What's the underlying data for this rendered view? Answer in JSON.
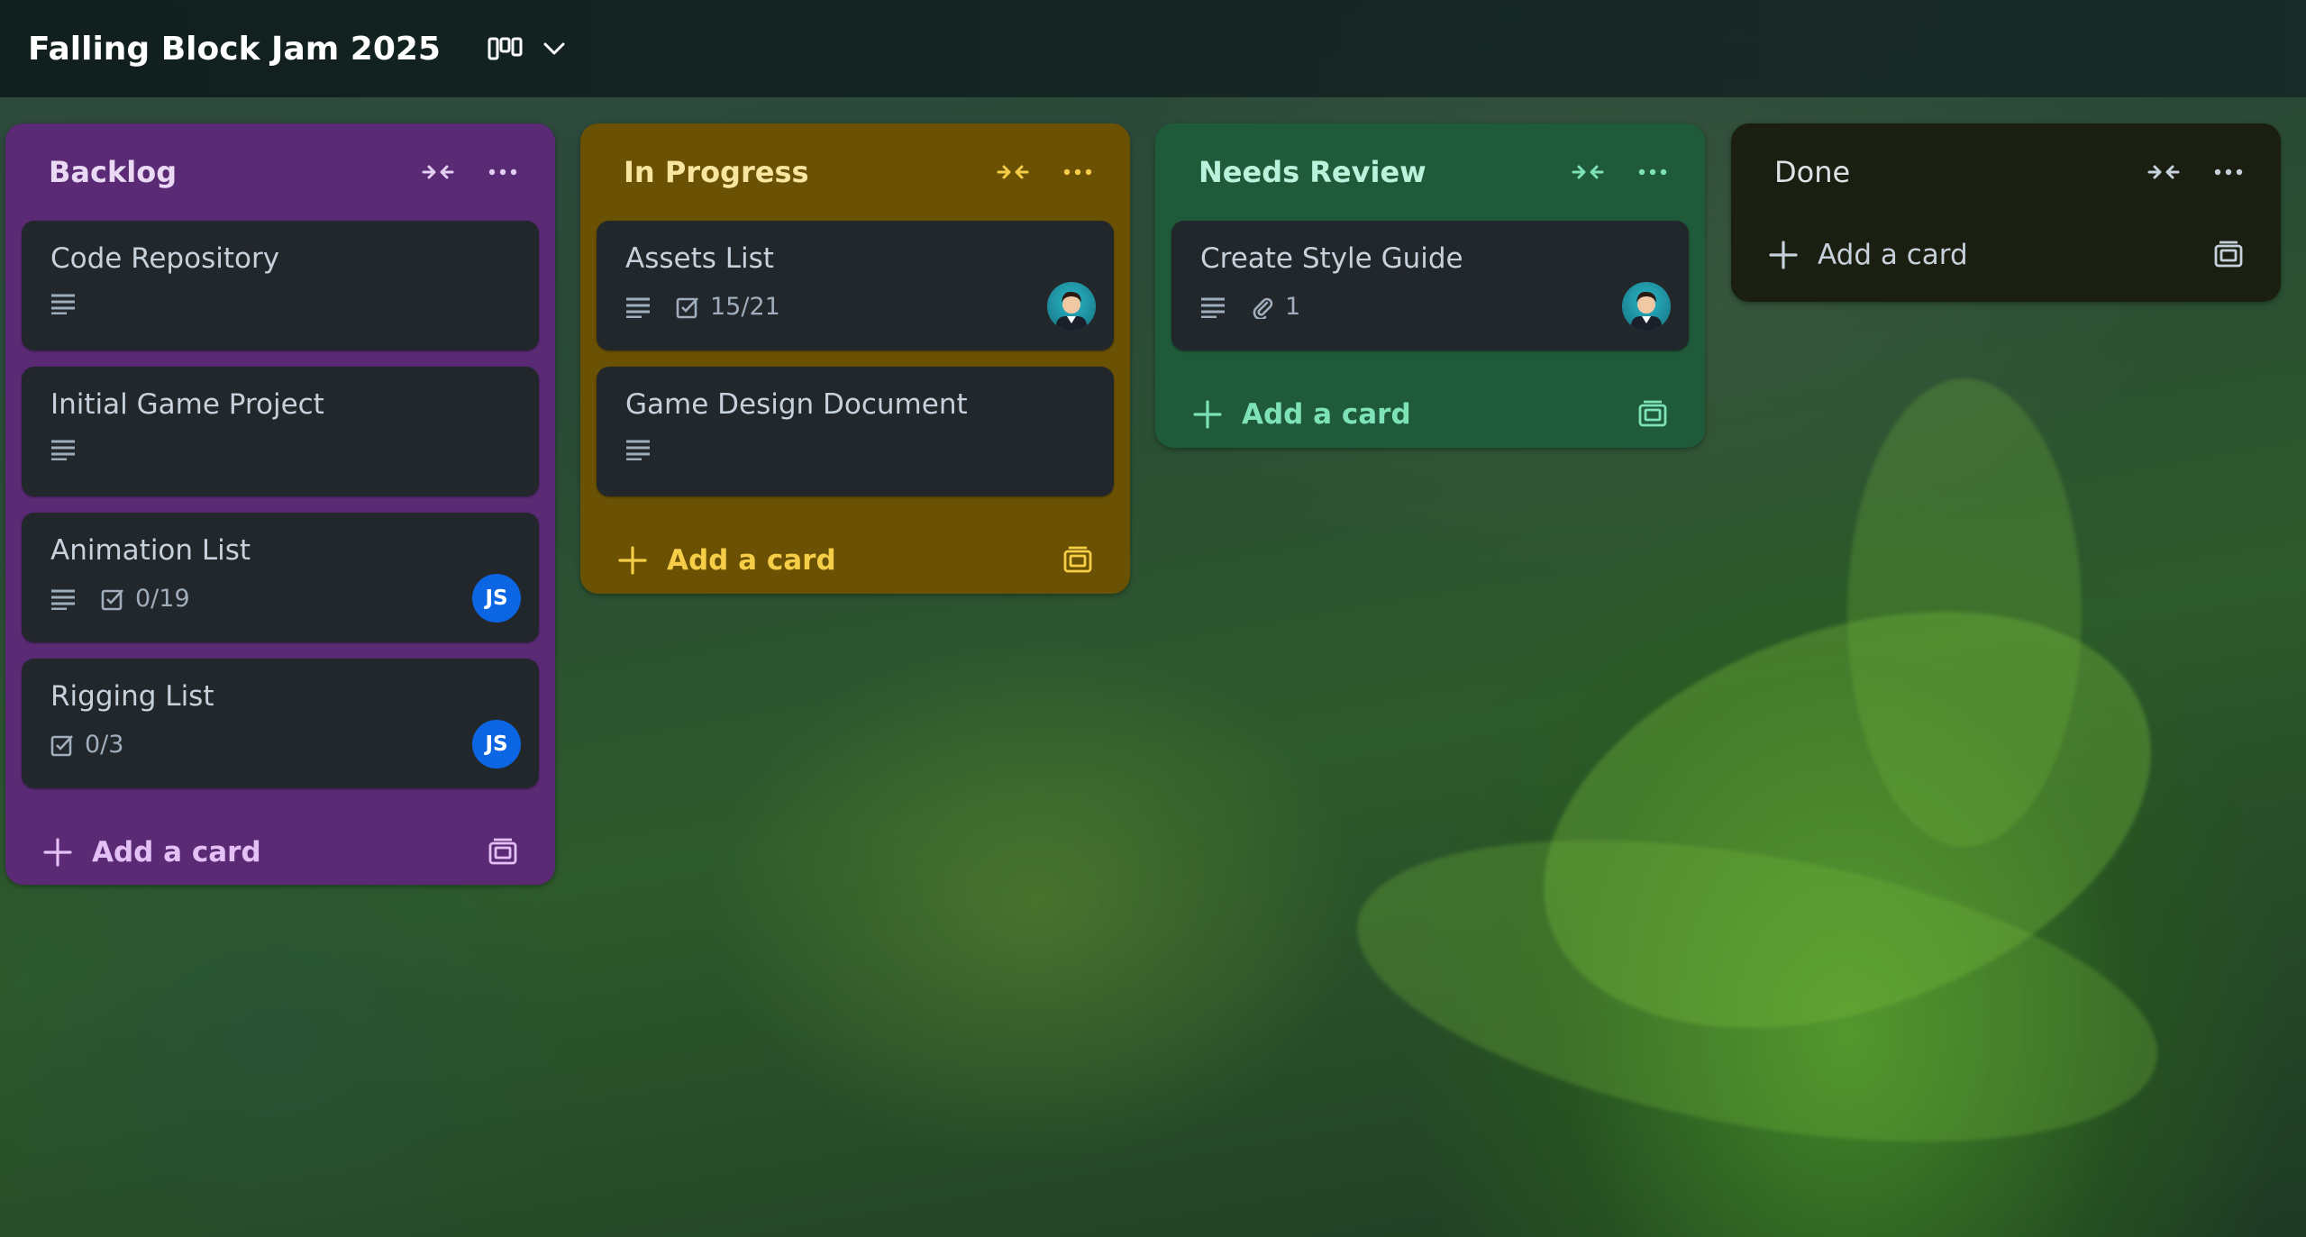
{
  "board": {
    "title": "Falling Block Jam 2025",
    "view_icon": "board-view-icon",
    "menu_icon": "chevron-down-icon"
  },
  "colors": {
    "backlog": "#5a2a75",
    "in_progress": "#6b5103",
    "needs_review": "#1f5a3a",
    "done": "#1a1f12",
    "avatar_js": "#0c66e4"
  },
  "lists": [
    {
      "title": "Backlog",
      "add_label": "Add a card",
      "cards": [
        {
          "title": "Code Repository"
        },
        {
          "title": "Initial Game Project"
        },
        {
          "title": "Animation List",
          "checklist": "0/19",
          "avatar": "JS"
        },
        {
          "title": "Rigging List",
          "checklist": "0/3",
          "avatar": "JS"
        }
      ]
    },
    {
      "title": "In Progress",
      "add_label": "Add a card",
      "cards": [
        {
          "title": "Assets List",
          "checklist": "15/21"
        },
        {
          "title": "Game Design Document"
        }
      ]
    },
    {
      "title": "Needs Review",
      "add_label": "Add a card",
      "cards": [
        {
          "title": "Create Style Guide",
          "attachments": "1"
        }
      ]
    },
    {
      "title": "Done",
      "add_label": "Add a card",
      "cards": []
    }
  ]
}
